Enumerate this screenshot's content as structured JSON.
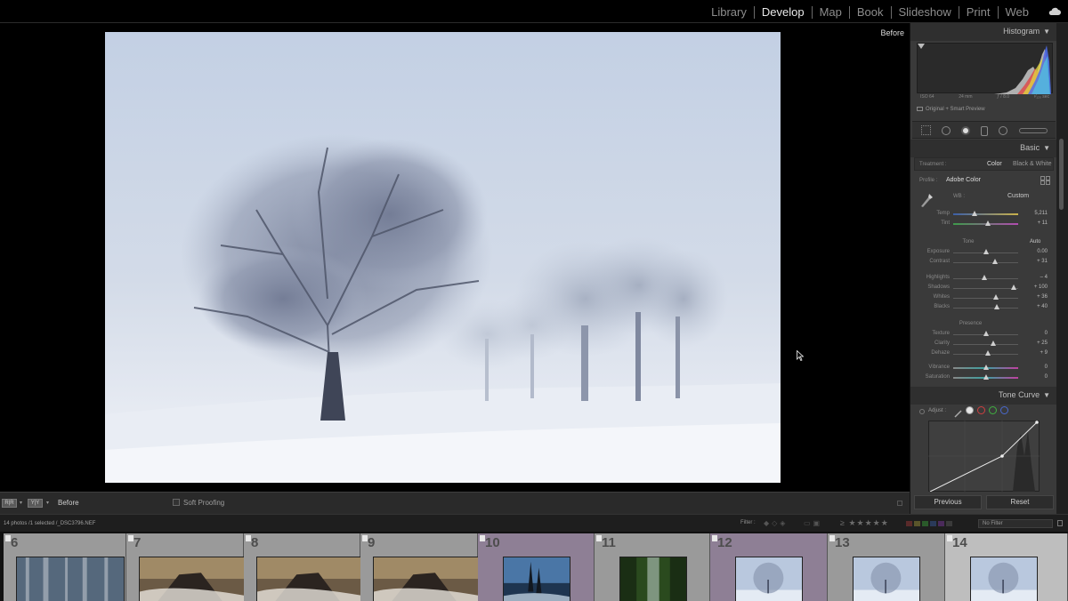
{
  "modules": [
    "Library",
    "Develop",
    "Map",
    "Book",
    "Slideshow",
    "Print",
    "Web"
  ],
  "active_module": "Develop",
  "viewer": {
    "before_label": "Before"
  },
  "histogram": {
    "title": "Histogram",
    "iso": "ISO 64",
    "focal": "24 mm",
    "aperture": "ƒ / 8.0",
    "shutter": "¹⁄₁₂₅ sec",
    "preview": "Original + Smart Preview"
  },
  "basic": {
    "title": "Basic",
    "treatment_label": "Treatment :",
    "treatment_color": "Color",
    "treatment_bw": "Black & White",
    "profile_label": "Profile :",
    "profile_value": "Adobe Color",
    "wb_label": "WB :",
    "wb_value": "Custom",
    "tone_label": "Tone",
    "tone_auto": "Auto",
    "presence_label": "Presence",
    "sliders": {
      "temp": {
        "label": "Temp",
        "value": "5,211",
        "pos": 0.33
      },
      "tint": {
        "label": "Tint",
        "value": "+ 11",
        "pos": 0.54
      },
      "exposure": {
        "label": "Exposure",
        "value": "0.00",
        "pos": 0.5
      },
      "contrast": {
        "label": "Contrast",
        "value": "+ 31",
        "pos": 0.64
      },
      "highlights": {
        "label": "Highlights",
        "value": "– 4",
        "pos": 0.48
      },
      "shadows": {
        "label": "Shadows",
        "value": "+ 100",
        "pos": 0.93
      },
      "whites": {
        "label": "Whites",
        "value": "+ 36",
        "pos": 0.66
      },
      "blacks": {
        "label": "Blacks",
        "value": "+ 40",
        "pos": 0.67
      },
      "texture": {
        "label": "Texture",
        "value": "0",
        "pos": 0.5
      },
      "clarity": {
        "label": "Clarity",
        "value": "+ 25",
        "pos": 0.61
      },
      "dehaze": {
        "label": "Dehaze",
        "value": "+ 9",
        "pos": 0.53
      },
      "vibrance": {
        "label": "Vibrance",
        "value": "0",
        "pos": 0.5
      },
      "saturation": {
        "label": "Saturation",
        "value": "0",
        "pos": 0.5
      }
    }
  },
  "tone_curve": {
    "title": "Tone Curve",
    "adjust_label": "Adjust :"
  },
  "nav": {
    "previous": "Previous",
    "reset": "Reset"
  },
  "toolbar": {
    "before_after_1": "R|R",
    "before_after_2": "Y|Y",
    "before_label": "Before",
    "soft_proofing": "Soft Proofing"
  },
  "filmstrip_bar": {
    "info": "14 photos /1 selected /_DSC3796.NEF",
    "filter_label": "Filter :",
    "stars": "≥ ★★★★★",
    "no_filter": "No Filter"
  },
  "filmstrip": [
    {
      "num": "6",
      "kind": "forest"
    },
    {
      "num": "7",
      "kind": "rock"
    },
    {
      "num": "8",
      "kind": "rock"
    },
    {
      "num": "9",
      "kind": "rock"
    },
    {
      "num": "10",
      "kind": "stack"
    },
    {
      "num": "11",
      "kind": "waterfall"
    },
    {
      "num": "12",
      "kind": "snowtree"
    },
    {
      "num": "13",
      "kind": "snowtree"
    },
    {
      "num": "14",
      "kind": "snowtree"
    }
  ],
  "colors": {
    "panel": "#3a3a3a",
    "selected_cell": "#bebebe",
    "active_cell": "#8e7f95"
  }
}
